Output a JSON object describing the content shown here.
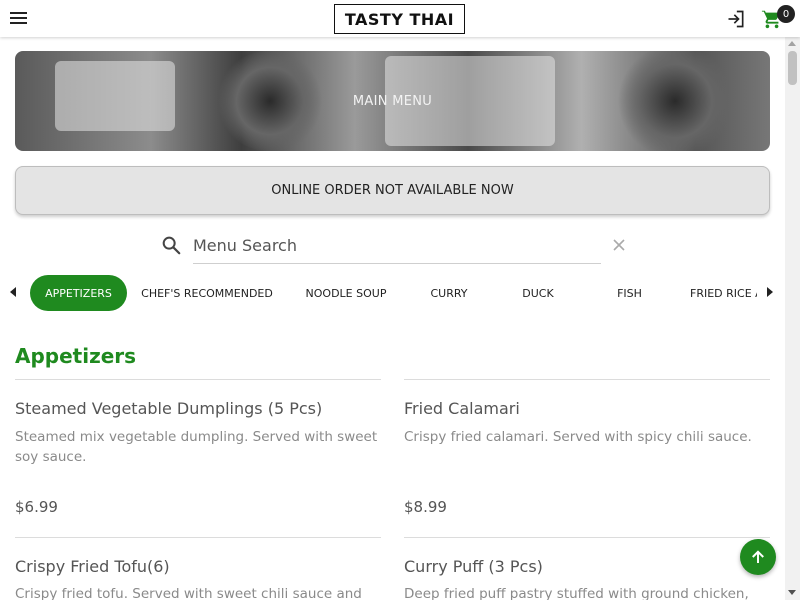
{
  "header": {
    "logo_text": "TASTY THAI",
    "cart_count": "0"
  },
  "banner": {
    "title": "MAIN MENU"
  },
  "order_status": {
    "label": "ONLINE ORDER NOT AVAILABLE NOW"
  },
  "search": {
    "placeholder": "Menu Search"
  },
  "categories": [
    {
      "label": "APPETIZERS",
      "active": true
    },
    {
      "label": "CHEF'S RECOMMENDED",
      "active": false
    },
    {
      "label": "NOODLE SOUP",
      "active": false
    },
    {
      "label": "CURRY",
      "active": false
    },
    {
      "label": "DUCK",
      "active": false
    },
    {
      "label": "FISH",
      "active": false
    },
    {
      "label": "FRIED RICE A",
      "active": false
    }
  ],
  "section": {
    "title": "Appetizers"
  },
  "items": [
    {
      "name": "Steamed Vegetable Dumplings (5 Pcs)",
      "description": "Steamed mix vegetable dumpling. Served with sweet soy sauce.",
      "price": "$6.99"
    },
    {
      "name": "Fried Calamari",
      "description": "Crispy fried calamari. Served with spicy chili sauce.",
      "price": "$8.99"
    },
    {
      "name": "Crispy Fried Tofu(6)",
      "description": "Crispy fried tofu. Served with sweet chili sauce and",
      "price": ""
    },
    {
      "name": "Curry Puff (3 Pcs)",
      "description": "Deep fried puff pastry stuffed with ground chicken,",
      "price": ""
    }
  ],
  "colors": {
    "accent": "#1f8a1f"
  },
  "icons": {
    "menu": "hamburger-icon",
    "login": "login-icon",
    "cart": "cart-icon",
    "search": "search-icon",
    "clear": "close-icon",
    "back_to_top": "arrow-up-icon"
  }
}
